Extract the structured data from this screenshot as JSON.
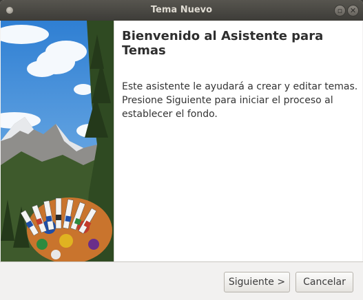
{
  "window": {
    "title": "Tema Nuevo"
  },
  "main": {
    "heading": "Bienvenido al Asistente para Temas",
    "body_lines": [
      "Este asistente le ayudará a crear y editar temas.",
      "Presione Siguiente para iniciar el proceso al",
      "establecer el fondo."
    ]
  },
  "footer": {
    "next_label": "Siguiente >",
    "cancel_label": "Cancelar"
  }
}
